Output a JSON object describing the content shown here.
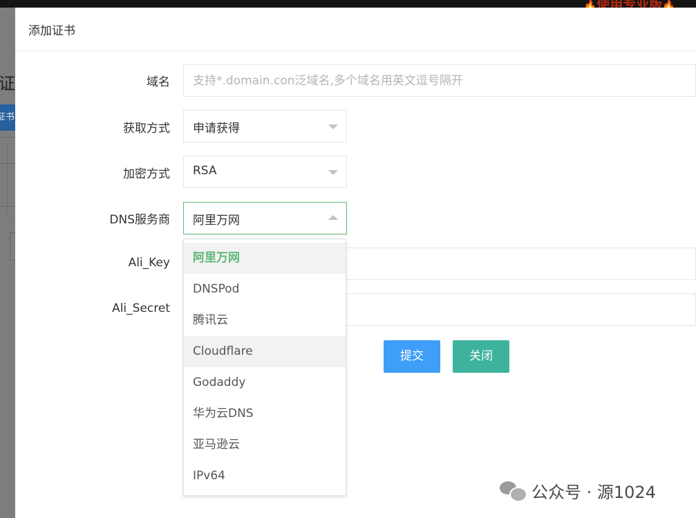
{
  "background": {
    "promo_text": "使用专业版",
    "heading_fragment": "证书",
    "button_fragment": "证书"
  },
  "modal": {
    "title": "添加证书",
    "fields": {
      "domain": {
        "label": "域名",
        "value": "",
        "placeholder": "支持*.domain.con泛域名,多个域名用英文逗号隔开"
      },
      "acquire_method": {
        "label": "获取方式",
        "value": "申请获得"
      },
      "encryption": {
        "label": "加密方式",
        "value": "RSA"
      },
      "dns_provider": {
        "label": "DNS服务商",
        "value": "阿里万网",
        "options": [
          "阿里万网",
          "DNSPod",
          "腾讯云",
          "Cloudflare",
          "Godaddy",
          "华为云DNS",
          "亚马逊云",
          "IPv64"
        ],
        "selected_index": 0,
        "hover_index": 3
      },
      "ali_key": {
        "label": "Ali_Key",
        "value": ""
      },
      "ali_secret": {
        "label": "Ali_Secret",
        "value": ""
      }
    },
    "buttons": {
      "submit_label": "提交",
      "close_label": "关闭"
    }
  },
  "watermark": {
    "text": "公众号 · 源1024"
  },
  "colors": {
    "accent_green": "#5fb878",
    "submit_blue": "#3e9ef8",
    "close_teal": "#3db39e"
  },
  "icons": {
    "select_caret": "caret-down-icon",
    "select_caret_open": "caret-up-icon",
    "watermark_logo": "wechat-icon"
  }
}
